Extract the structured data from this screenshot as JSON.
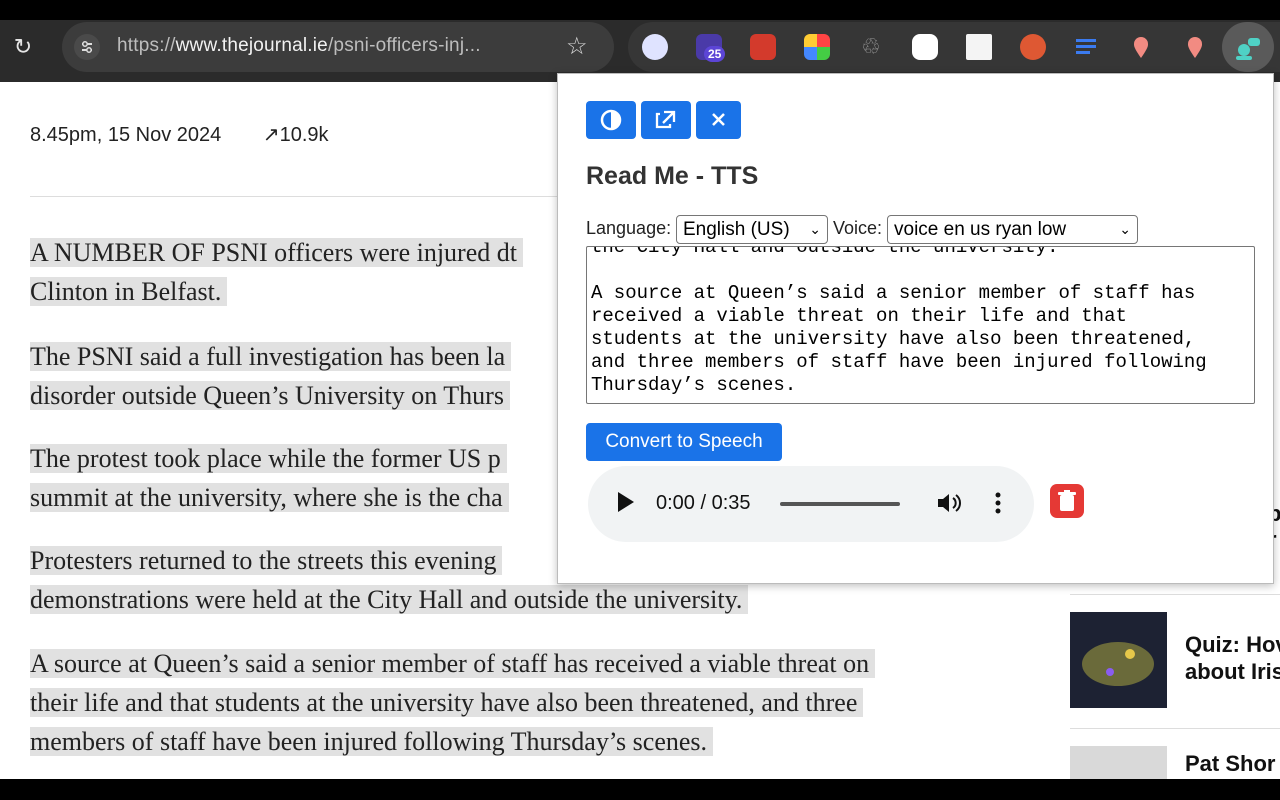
{
  "browser": {
    "url_scheme": "https://",
    "url_domain": "www.thejournal.ie",
    "url_path": "/psni-officers-inj...",
    "extension_badge": "25",
    "reload_icon": "reload-icon",
    "star_icon": "star-icon"
  },
  "article": {
    "meta_time": "8.45pm, 15 Nov 2024",
    "meta_views": "10.9k",
    "paragraphs": [
      "A NUMBER OF PSNI officers were injured dt",
      "Clinton in Belfast.",
      "The PSNI said a full investigation has been la",
      "disorder outside Queen’s University on Thurs",
      "The protest took place while the former US p",
      "summit at the university, where she is the cha",
      "Protesters returned to the streets this evening",
      "demonstrations were held at the City Hall and outside the university.",
      "A source at Queen’s said a senior member of staff has received a viable threat on",
      "their life and that students at the university have also been threatened, and three",
      "members of staff have been injured following Thursday’s scenes."
    ]
  },
  "sidebar": {
    "partial_text_1": "p",
    "partial_text_2": "r",
    "item1_title_line1": "Quiz: Hov",
    "item1_title_line2": "about Iris",
    "item2_title": "Pat Shor"
  },
  "popup": {
    "title": "Read Me - TTS",
    "language_label": "Language:",
    "language_value": "English (US)",
    "voice_label": "Voice:",
    "voice_value": "voice en us ryan low",
    "text_content": "the City Hall and outside the university.\n\nA source at Queen’s said a senior member of staff has\nreceived a viable threat on their life and that\nstudents at the university have also been threatened,\nand three members of staff have been injured following\nThursday’s scenes.",
    "convert_label": "Convert to Speech",
    "audio_time": "0:00 / 0:35",
    "accent_color": "#1a73e8",
    "delete_color": "#e53935"
  }
}
